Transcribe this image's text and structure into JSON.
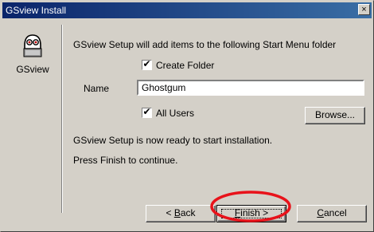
{
  "window": {
    "title": "GSview Install",
    "close_glyph": "×"
  },
  "sidebar": {
    "app_name": "GSview",
    "icon": "gsview-ghost-icon"
  },
  "main": {
    "intro": "GSview Setup will add items to the following Start Menu folder",
    "create_folder": {
      "label": "Create Folder",
      "checked": true
    },
    "name_label": "Name",
    "name_value": "Ghostgum",
    "all_users": {
      "label": "All Users",
      "checked": true
    },
    "browse_label": "Browse...",
    "ready_text": "GSview Setup is now ready to start installation.",
    "press_text": "Press Finish to continue."
  },
  "buttons": {
    "back": {
      "label": "< Back",
      "accesskey": "B"
    },
    "finish": {
      "label": "Finish >",
      "accesskey": "F"
    },
    "cancel": {
      "label": "Cancel",
      "accesskey": "C"
    }
  },
  "annotation": {
    "color": "#e8121a",
    "shape": "red-ellipse-highlight"
  }
}
